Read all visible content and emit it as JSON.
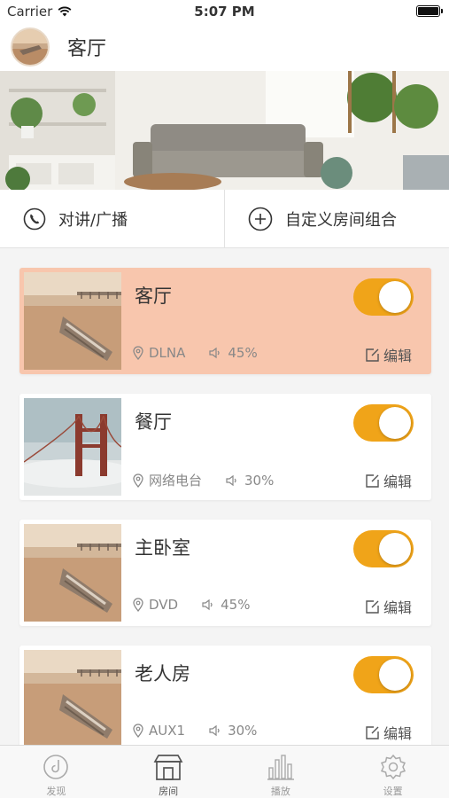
{
  "status_bar": {
    "carrier": "Carrier",
    "time": "5:07 PM"
  },
  "header": {
    "title": "客厅"
  },
  "actions": [
    {
      "label": "对讲/广播",
      "icon": "phone-icon"
    },
    {
      "label": "自定义房间组合",
      "icon": "plus-circle-icon"
    }
  ],
  "rooms": [
    {
      "name": "客厅",
      "source": "DLNA",
      "volume": "45%",
      "edit": "编辑",
      "on": true,
      "active": true,
      "thumb": "beach-boat"
    },
    {
      "name": "餐厅",
      "source": "网络电台",
      "volume": "30%",
      "edit": "编辑",
      "on": true,
      "active": false,
      "thumb": "bridge-fog"
    },
    {
      "name": "主卧室",
      "source": "DVD",
      "volume": "45%",
      "edit": "编辑",
      "on": true,
      "active": false,
      "thumb": "beach-boat"
    },
    {
      "name": "老人房",
      "source": "AUX1",
      "volume": "30%",
      "edit": "编辑",
      "on": true,
      "active": false,
      "thumb": "beach-boat"
    }
  ],
  "tabs": [
    {
      "label": "发现",
      "icon": "discover-icon",
      "active": false
    },
    {
      "label": "房间",
      "icon": "house-icon",
      "active": true
    },
    {
      "label": "播放",
      "icon": "bars-icon",
      "active": false
    },
    {
      "label": "设置",
      "icon": "gear-icon",
      "active": false
    }
  ],
  "colors": {
    "accent": "#f0a419",
    "active_card": "#f8c6ad"
  }
}
